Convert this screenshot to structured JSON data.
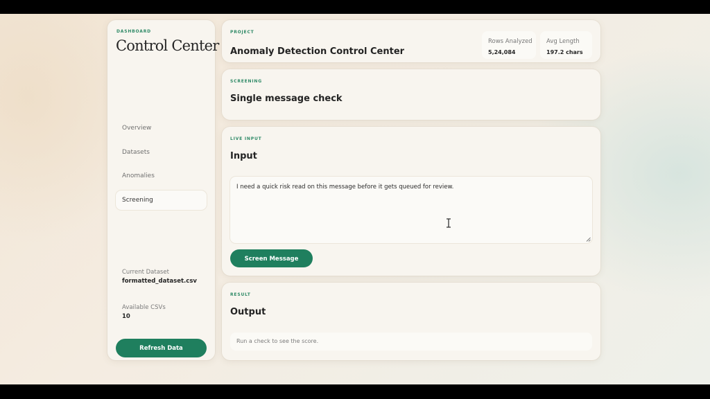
{
  "sidebar": {
    "kicker": "DASHBOARD",
    "brand": "Control Center",
    "nav": [
      {
        "label": "Overview"
      },
      {
        "label": "Datasets"
      },
      {
        "label": "Anomalies"
      },
      {
        "label": "Screening",
        "active": true
      }
    ],
    "current_dataset_label": "Current Dataset",
    "current_dataset_value": "formatted_dataset.csv",
    "available_csvs_label": "Available CSVs",
    "available_csvs_value": "10",
    "refresh_label": "Refresh Data"
  },
  "project": {
    "kicker": "PROJECT",
    "title": "Anomaly Detection Control Center",
    "stats": [
      {
        "label": "Rows Analyzed",
        "value": "5,24,084"
      },
      {
        "label": "Avg Length",
        "value": "197.2 chars"
      }
    ]
  },
  "screening": {
    "kicker": "SCREENING",
    "title": "Single message check"
  },
  "live_input": {
    "kicker": "LIVE INPUT",
    "title": "Input",
    "message": "I need a quick risk read on this message before it gets queued for review.",
    "button_label": "Screen Message"
  },
  "result": {
    "kicker": "RESULT",
    "title": "Output",
    "placeholder": "Run a check to see the score."
  },
  "colors": {
    "accent": "#1f7f5e",
    "kicker": "#2f8a67",
    "card": "#f8f5ef"
  },
  "icons": [
    "text-cursor-icon",
    "resize-grip-icon"
  ]
}
